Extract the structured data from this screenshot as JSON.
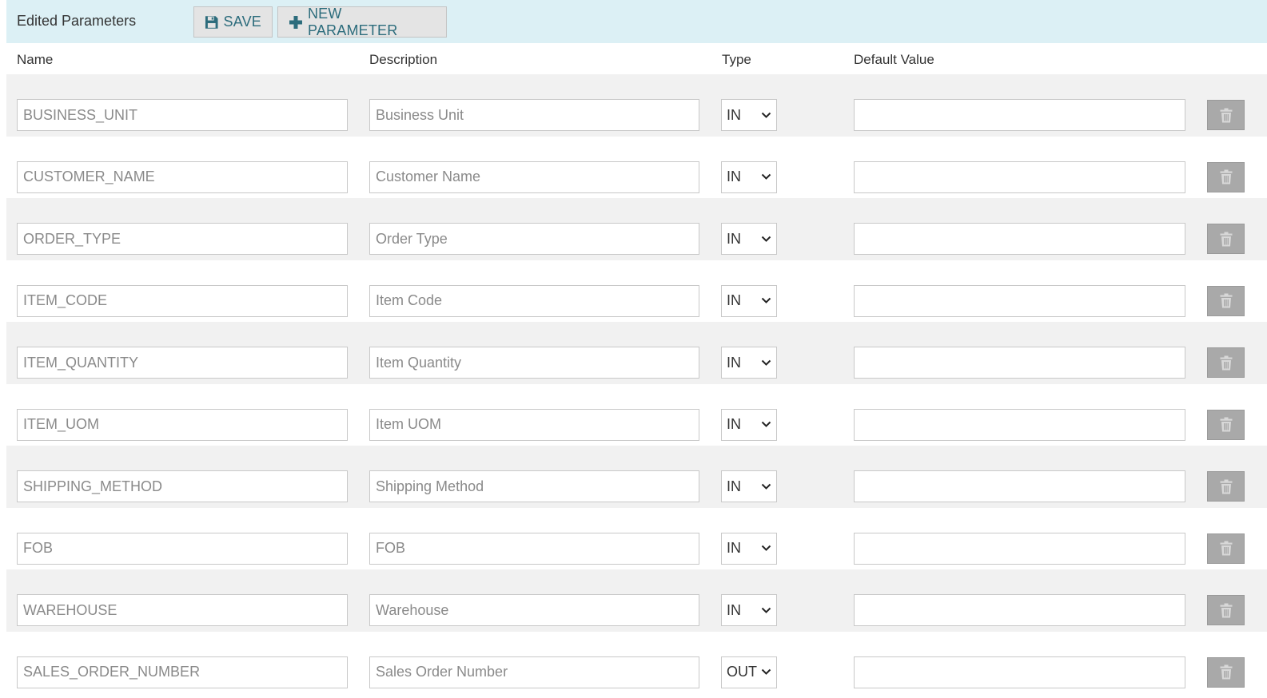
{
  "toolbar": {
    "title": "Edited Parameters",
    "save_label": "SAVE",
    "new_label": "NEW PARAMETER"
  },
  "headers": {
    "name": "Name",
    "description": "Description",
    "type": "Type",
    "default": "Default Value"
  },
  "rows": [
    {
      "name": "BUSINESS_UNIT",
      "description": "Business Unit",
      "type": "IN",
      "default": ""
    },
    {
      "name": "CUSTOMER_NAME",
      "description": "Customer Name",
      "type": "IN",
      "default": ""
    },
    {
      "name": "ORDER_TYPE",
      "description": "Order Type",
      "type": "IN",
      "default": ""
    },
    {
      "name": "ITEM_CODE",
      "description": "Item Code",
      "type": "IN",
      "default": ""
    },
    {
      "name": "ITEM_QUANTITY",
      "description": "Item Quantity",
      "type": "IN",
      "default": ""
    },
    {
      "name": "ITEM_UOM",
      "description": "Item UOM",
      "type": "IN",
      "default": ""
    },
    {
      "name": "SHIPPING_METHOD",
      "description": "Shipping Method",
      "type": "IN",
      "default": ""
    },
    {
      "name": "FOB",
      "description": "FOB",
      "type": "IN",
      "default": ""
    },
    {
      "name": "WAREHOUSE",
      "description": "Warehouse",
      "type": "IN",
      "default": ""
    },
    {
      "name": "SALES_ORDER_NUMBER",
      "description": "Sales Order Number",
      "type": "OUT",
      "default": ""
    }
  ],
  "icons": {
    "save": "floppy-disk-icon",
    "new": "plus-icon",
    "delete": "trash-icon",
    "dropdown": "chevron-down-icon"
  },
  "colors": {
    "toolbar_bg": "#dcf0f5",
    "button_text": "#2c6c7c",
    "row_alt": "#f1f1f1",
    "delete_bg": "#a9a9a9"
  }
}
